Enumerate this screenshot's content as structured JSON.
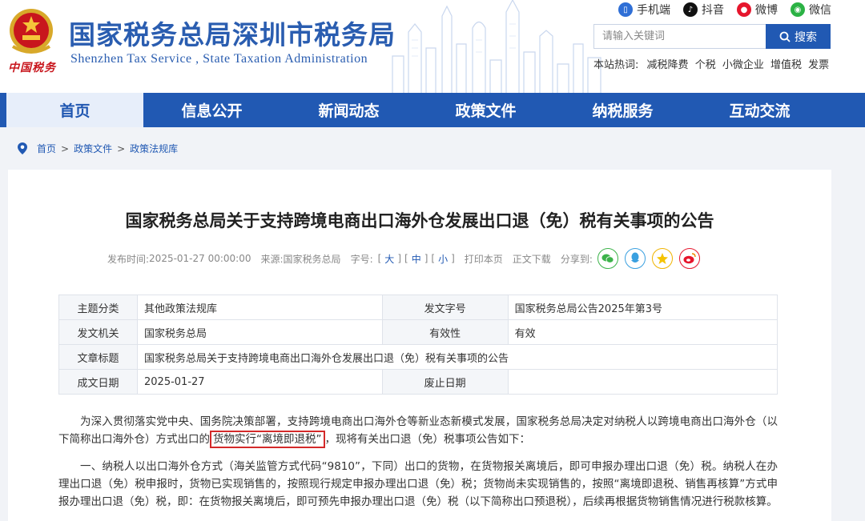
{
  "header": {
    "title": "国家税务总局深圳市税务局",
    "subtitle": "Shenzhen Tax Service , State Taxation Administration",
    "emblem_text": "中国税务",
    "apps": [
      {
        "label": "手机端",
        "icon": "mobile-icon",
        "color": "#2f6fd6"
      },
      {
        "label": "抖音",
        "icon": "douyin-icon",
        "color": "#111111"
      },
      {
        "label": "微博",
        "icon": "weibo-icon",
        "color": "#e6162d"
      },
      {
        "label": "微信",
        "icon": "wechat-icon",
        "color": "#2bb244"
      }
    ],
    "search": {
      "placeholder": "请输入关键词",
      "button_label": "搜索"
    },
    "hot_label": "本站热词:",
    "hot_words": [
      "减税降费",
      "个税",
      "小微企业",
      "增值税",
      "发票"
    ]
  },
  "nav": {
    "items": [
      "首页",
      "信息公开",
      "新闻动态",
      "政策文件",
      "纳税服务",
      "互动交流"
    ],
    "active_index": 0
  },
  "breadcrumb": [
    "首页",
    "政策文件",
    "政策法规库"
  ],
  "article": {
    "title": "国家税务总局关于支持跨境电商出口海外仓发展出口退（免）税有关事项的公告",
    "meta": {
      "publish_label": "发布时间:",
      "publish_time": "2025-01-27 00:00:00",
      "source_label": "来源:",
      "source": "国家税务总局",
      "font_label": "字号:",
      "sizes": [
        "大",
        "中",
        "小"
      ],
      "print": "打印本页",
      "close": "正文下载",
      "share_label": "分享到:"
    },
    "share_icons": [
      "wechat-icon",
      "qq-icon",
      "qzone-icon",
      "weibo-icon"
    ],
    "info": [
      {
        "l1": "主题分类",
        "v1": "其他政策法规库",
        "l2": "发文字号",
        "v2": "国家税务总局公告2025年第3号"
      },
      {
        "l1": "发文机关",
        "v1": "国家税务总局",
        "l2": "有效性",
        "v2": "有效"
      },
      {
        "l1": "文章标题",
        "v1": "国家税务总局关于支持跨境电商出口海外仓发展出口退（免）税有关事项的公告"
      },
      {
        "l1": "成文日期",
        "v1": "2025-01-27",
        "l2": "废止日期",
        "v2": ""
      }
    ],
    "p1_before": "为深入贯彻落实党中央、国务院决策部署，支持跨境电商出口海外仓等新业态新模式发展，国家税务总局决定对纳税人以跨境电商出口海外仓（以下简称出口海外仓）方式出口的",
    "p1_highlight": "货物实行“离境即退税”",
    "p1_after": "，现将有关出口退（免）税事项公告如下：",
    "p2": "一、纳税人以出口海外仓方式（海关监管方式代码“9810”，下同）出口的货物，在货物报关离境后，即可申报办理出口退（免）税。纳税人在办理出口退（免）税申报时，货物已实现销售的，按照现行规定申报办理出口退（免）税；货物尚未实现销售的，按照“离境即退税、销售再核算”方式申报办理出口退（免）税，即：在货物报关离境后，即可预先申报办理出口退（免）税（以下简称出口预退税），后续再根据货物销售情况进行税款核算。"
  }
}
